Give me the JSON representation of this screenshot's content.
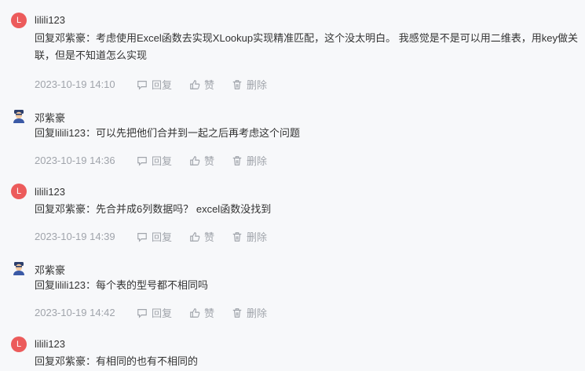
{
  "comments": [
    {
      "avatar": "L",
      "author": "lilili123",
      "text": "回复邓紫豪：考虑使用Excel函数去实现XLookup实现精准匹配，这个没太明白。 我感觉是不是可以用二维表，用key做关联，但是不知道怎么实现",
      "date": "2023-10-19 14:10",
      "reply": "回复",
      "like": "赞",
      "delete": "删除"
    },
    {
      "avatar": "",
      "author": "邓紫豪",
      "text": "回复lilili123：可以先把他们合并到一起之后再考虑这个问题",
      "date": "2023-10-19 14:36",
      "reply": "回复",
      "like": "赞",
      "delete": "删除"
    },
    {
      "avatar": "L",
      "author": "lilili123",
      "text": "回复邓紫豪：先合并成6列数据吗？ excel函数没找到",
      "date": "2023-10-19 14:39",
      "reply": "回复",
      "like": "赞",
      "delete": "删除"
    },
    {
      "avatar": "",
      "author": "邓紫豪",
      "text": "回复lilili123：每个表的型号都不相同吗",
      "date": "2023-10-19 14:42",
      "reply": "回复",
      "like": "赞",
      "delete": "删除"
    },
    {
      "avatar": "L",
      "author": "lilili123",
      "text": "回复邓紫豪：有相同的也有不相同的",
      "date": "",
      "reply": "",
      "like": "",
      "delete": ""
    }
  ],
  "colors": {
    "avatar_bg": "#ec5b5b",
    "meta": "#a0a4ab"
  }
}
